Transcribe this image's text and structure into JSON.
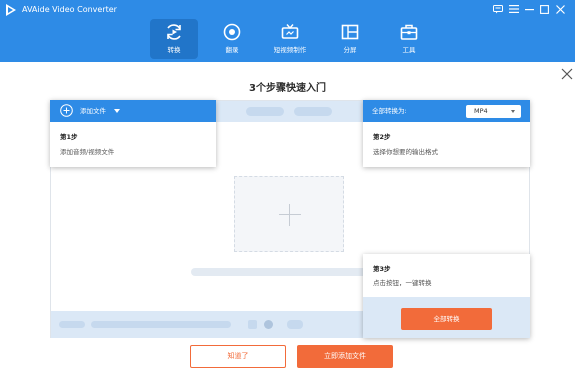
{
  "app": {
    "title": "AVAide Video Converter"
  },
  "nav": {
    "tabs": [
      {
        "label": "转换",
        "icon": "convert-icon",
        "active": true
      },
      {
        "label": "翻录",
        "icon": "ripper-icon",
        "active": false
      },
      {
        "label": "短视频制作",
        "icon": "mv-icon",
        "active": false
      },
      {
        "label": "分屏",
        "icon": "collage-icon",
        "active": false
      },
      {
        "label": "工具",
        "icon": "toolbox-icon",
        "active": false
      }
    ]
  },
  "window_controls": [
    "chat-icon",
    "menu-icon",
    "minimize-icon",
    "maximize-icon",
    "close-icon"
  ],
  "guide": {
    "title": "3个步骤快速入门",
    "step1": {
      "header_label": "添加文件",
      "num": "第1步",
      "desc": "添加音频/视频文件"
    },
    "step2": {
      "header_label": "全部转换为:",
      "format": "MP4",
      "num": "第2步",
      "desc": "选择你想要的输出格式"
    },
    "step3": {
      "num": "第3步",
      "desc": "点击按钮，一键转换",
      "button": "全部转换"
    }
  },
  "buttons": {
    "ok": "知道了",
    "add_now": "立即添加文件"
  },
  "colors": {
    "brand_blue": "#2e8be6",
    "active_tab": "#2175c9",
    "accent_orange": "#f26b3a"
  }
}
